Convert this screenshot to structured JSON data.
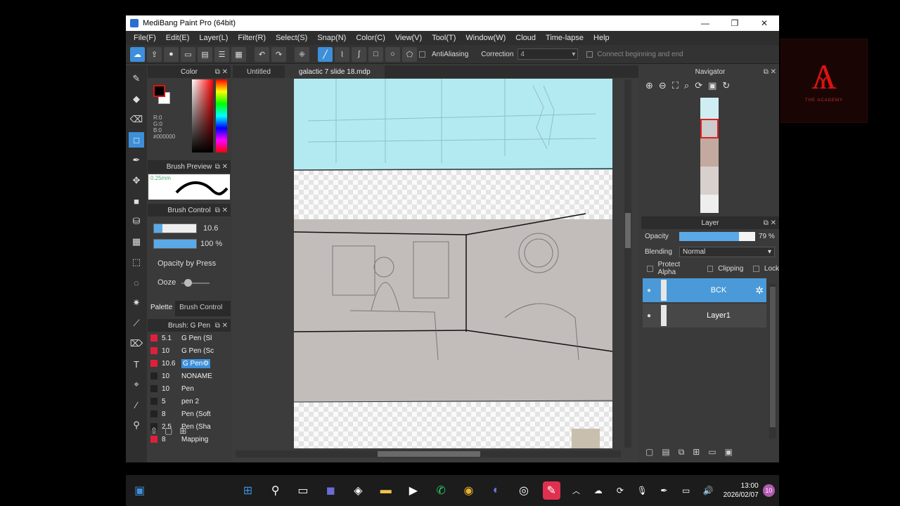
{
  "window": {
    "title": "MediBang Paint Pro (64bit)",
    "minimize": "—",
    "restore": "❐",
    "close": "✕"
  },
  "menu": [
    "File(F)",
    "Edit(E)",
    "Layer(L)",
    "Filter(R)",
    "Select(S)",
    "Snap(N)",
    "Color(C)",
    "View(V)",
    "Tool(T)",
    "Window(W)",
    "Cloud",
    "Time-lapse",
    "Help"
  ],
  "toolbar": {
    "antialias_label": "AntiAliasing",
    "correction_label": "Correction",
    "correction_value": "4",
    "connect_label": "Connect beginning and end"
  },
  "color_panel": {
    "title": "Color",
    "rgb_text": "R:0\nG:0\nB:0\n#000000",
    "fg_color": "#000000",
    "bg_color": "#ffffff"
  },
  "brush_preview": {
    "title": "Brush Preview",
    "size_text": "0.25mm"
  },
  "brush_control": {
    "title": "Brush Control",
    "size_value": "10.6",
    "opacity_value": "100 %",
    "opacity_by_pressure": "Opacity by Press",
    "ooze": "Ooze"
  },
  "tabs": {
    "palette": "Palette",
    "brush_control": "Brush Control"
  },
  "brush_list": {
    "title": "Brush: G Pen",
    "items": [
      {
        "size": "5.1",
        "name": "G Pen (Sl",
        "color": "#e0203a",
        "selected": false
      },
      {
        "size": "10",
        "name": "G Pen (Sc",
        "color": "#e0203a",
        "selected": false
      },
      {
        "size": "10.6",
        "name": "G Pen⚙",
        "color": "#e0203a",
        "selected": true
      },
      {
        "size": "10",
        "name": "NONAME",
        "color": "#222",
        "selected": false
      },
      {
        "size": "10",
        "name": "Pen",
        "color": "#222",
        "selected": false
      },
      {
        "size": "5",
        "name": "pen 2",
        "color": "#222",
        "selected": false
      },
      {
        "size": "8",
        "name": "Pen (Soft",
        "color": "#222",
        "selected": false
      },
      {
        "size": "2.5",
        "name": "Pen (Sha",
        "color": "#222",
        "selected": false
      },
      {
        "size": "8",
        "name": "Mapping",
        "color": "#e0203a",
        "selected": false
      }
    ]
  },
  "document_tabs": [
    {
      "label": "Untitled",
      "selected": false
    },
    {
      "label": "galactic 7 slide 18.mdp",
      "selected": true
    }
  ],
  "navigator": {
    "title": "Navigator"
  },
  "layer_panel": {
    "title": "Layer",
    "opacity_label": "Opacity",
    "opacity_value": "79 %",
    "opacity_fraction": 0.79,
    "blending_label": "Blending",
    "blending_value": "Normal",
    "protect_alpha": "Protect Alpha",
    "clipping": "Clipping",
    "lock": "Lock",
    "layers": [
      {
        "name": "BCK",
        "selected": true
      },
      {
        "name": "Layer1",
        "selected": false
      }
    ]
  },
  "taskbar": {
    "time": "13:00",
    "date": "2026/02/07",
    "notif_count": "10"
  },
  "logo": {
    "text": "THE ACADEMY"
  }
}
